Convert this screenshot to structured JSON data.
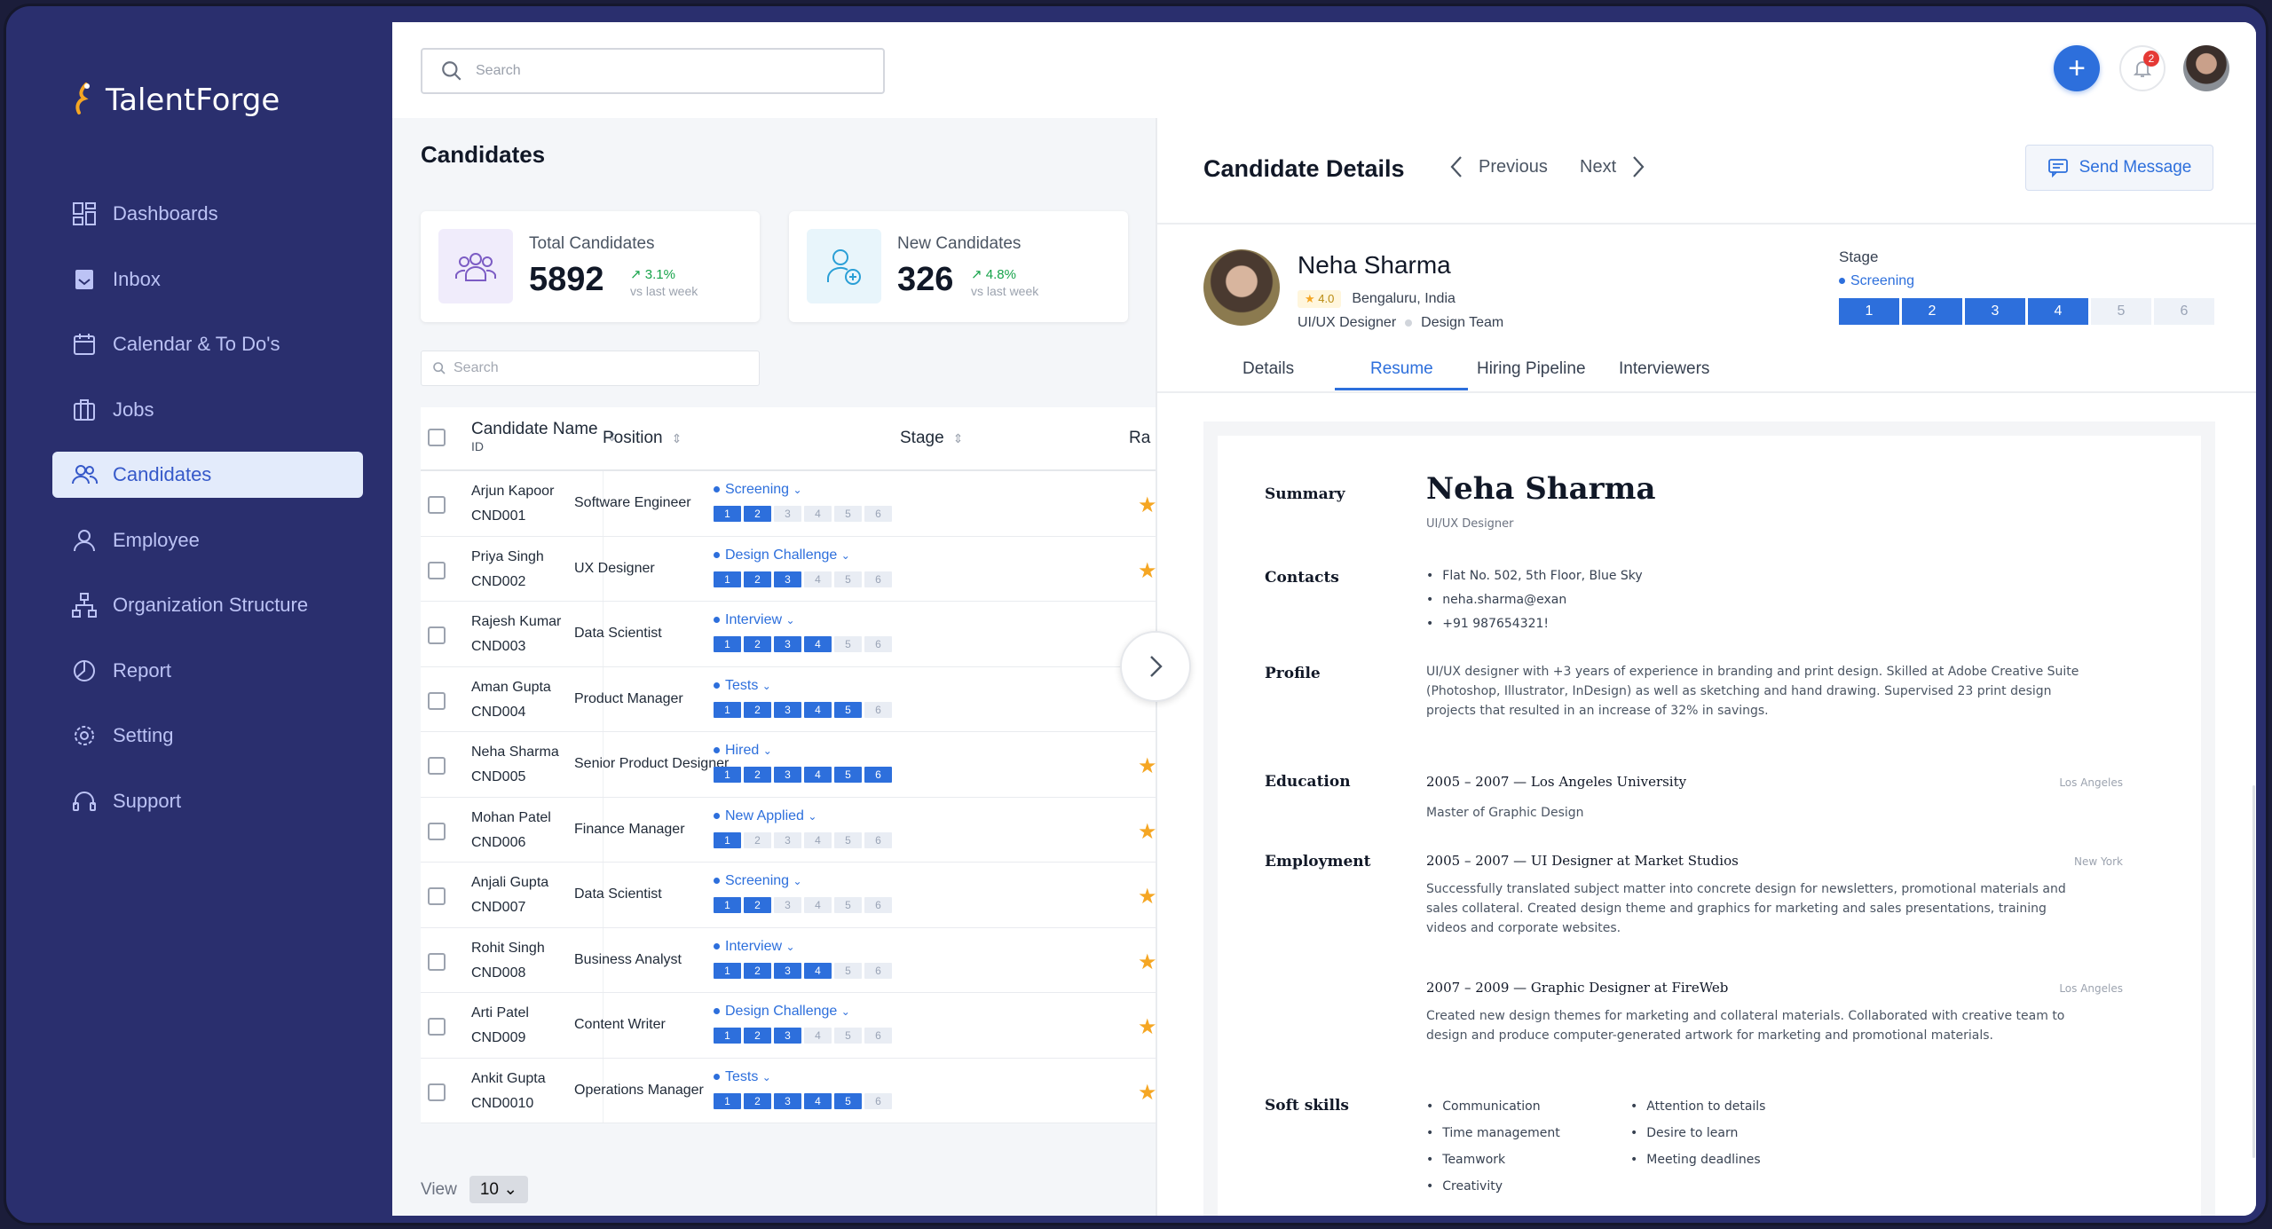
{
  "app": {
    "name": "TalentForge"
  },
  "sidebar": {
    "items": [
      {
        "label": "Dashboards",
        "icon": "dashboard-icon"
      },
      {
        "label": "Inbox",
        "icon": "inbox-icon"
      },
      {
        "label": "Calendar & To Do's",
        "icon": "calendar-icon"
      },
      {
        "label": "Jobs",
        "icon": "briefcase-icon"
      },
      {
        "label": "Candidates",
        "icon": "users-icon",
        "active": true
      },
      {
        "label": "Employee",
        "icon": "user-icon"
      },
      {
        "label": "Organization Structure",
        "icon": "org-chart-icon"
      },
      {
        "label": "Report",
        "icon": "pie-chart-icon"
      },
      {
        "label": "Setting",
        "icon": "gear-icon"
      },
      {
        "label": "Support",
        "icon": "headset-icon"
      }
    ]
  },
  "topbar": {
    "search_placeholder": "Search",
    "notification_count": "2"
  },
  "candidates": {
    "title": "Candidates",
    "stats": [
      {
        "label": "Total Candidates",
        "value": "5892",
        "trend": "3.1%",
        "sub": "vs last week"
      },
      {
        "label": "New Candidates",
        "value": "326",
        "trend": "4.8%",
        "sub": "vs last week"
      }
    ],
    "search_placeholder": "Search",
    "columns": {
      "name": "Candidate Name",
      "name_sub": "ID",
      "position": "Position",
      "stage": "Stage",
      "rating": "Ra"
    },
    "rows": [
      {
        "name": "Arjun Kapoor",
        "id": "CND001",
        "position": "Software Engineer",
        "stage": "Screening",
        "level": 2
      },
      {
        "name": "Priya Singh",
        "id": "CND002",
        "position": "UX Designer",
        "stage": "Design Challenge",
        "level": 3
      },
      {
        "name": "Rajesh Kumar",
        "id": "CND003",
        "position": "Data Scientist",
        "stage": "Interview",
        "level": 4
      },
      {
        "name": "Aman Gupta",
        "id": "CND004",
        "position": "Product Manager",
        "stage": "Tests",
        "level": 5
      },
      {
        "name": "Neha Sharma",
        "id": "CND005",
        "position": "Senior Product Designer",
        "stage": "Hired",
        "level": 6
      },
      {
        "name": "Mohan Patel",
        "id": "CND006",
        "position": "Finance Manager",
        "stage": "New Applied",
        "level": 1
      },
      {
        "name": "Anjali Gupta",
        "id": "CND007",
        "position": "Data Scientist",
        "stage": "Screening",
        "level": 2
      },
      {
        "name": "Rohit Singh",
        "id": "CND008",
        "position": "Business Analyst",
        "stage": "Interview",
        "level": 4
      },
      {
        "name": "Arti Patel",
        "id": "CND009",
        "position": "Content Writer",
        "stage": "Design Challenge",
        "level": 3
      },
      {
        "name": "Ankit Gupta",
        "id": "CND0010",
        "position": "Operations Manager",
        "stage": "Tests",
        "level": 5
      }
    ],
    "view_label": "View",
    "view_value": "10"
  },
  "detail": {
    "title": "Candidate Details",
    "prev": "Previous",
    "next": "Next",
    "send": "Send Message",
    "name": "Neha Sharma",
    "rating": "4.0",
    "location": "Bengaluru, India",
    "role": "UI/UX Designer",
    "team": "Design Team",
    "stage_title": "Stage",
    "stage": "Screening",
    "stage_level": 4,
    "tabs": [
      "Details",
      "Resume",
      "Hiring Pipeline",
      "Interviewers"
    ],
    "active_tab": "Resume"
  },
  "resume": {
    "name": "Neha Sharma",
    "role": "UI/UX Designer",
    "sections": {
      "summary": "Summary",
      "contacts": "Contacts",
      "profile": "Profile",
      "education": "Education",
      "employment": "Employment",
      "softskills": "Soft skills"
    },
    "contacts": [
      "Flat No. 502, 5th Floor, Blue Sky",
      "neha.sharma@exan",
      "+91 987654321!"
    ],
    "profile_lines": [
      "UI/UX designer with +3 years of experience in branding and print design. Skilled at Adobe Creative Suite",
      "(Photoshop, Illustrator, InDesign) as well as sketching and hand drawing. Supervised 23 print design",
      "projects that resulted in an increase of 32% in savings."
    ],
    "education": {
      "head": "2005 – 2007 — Los Angeles University",
      "loc": "Los Angeles",
      "degree": "Master of Graphic Design"
    },
    "jobs": [
      {
        "head": "2005 – 2007 — UI Designer at Market Studios",
        "loc": "New York",
        "lines": [
          "Successfully translated subject matter into concrete design for newsletters, promotional materials and",
          "sales collateral. Created design theme and graphics for marketing and sales presentations, training",
          "videos and corporate websites."
        ]
      },
      {
        "head": "2007 – 2009 — Graphic Designer at FireWeb",
        "loc": "Los Angeles",
        "lines": [
          "Created new design themes for marketing and collateral materials. Collaborated with creative team to",
          "design and produce computer-generated artwork for marketing and promotional materials."
        ]
      }
    ],
    "skills_left": [
      "Communication",
      "Time management",
      "Teamwork",
      "Creativity"
    ],
    "skills_right": [
      "Attention to details",
      "Desire to learn",
      "Meeting deadlines"
    ]
  },
  "colors": {
    "sidebar": "#2a2f6e",
    "accent": "#2d6fdc",
    "star": "#f5a623",
    "trend": "#16a34a"
  }
}
